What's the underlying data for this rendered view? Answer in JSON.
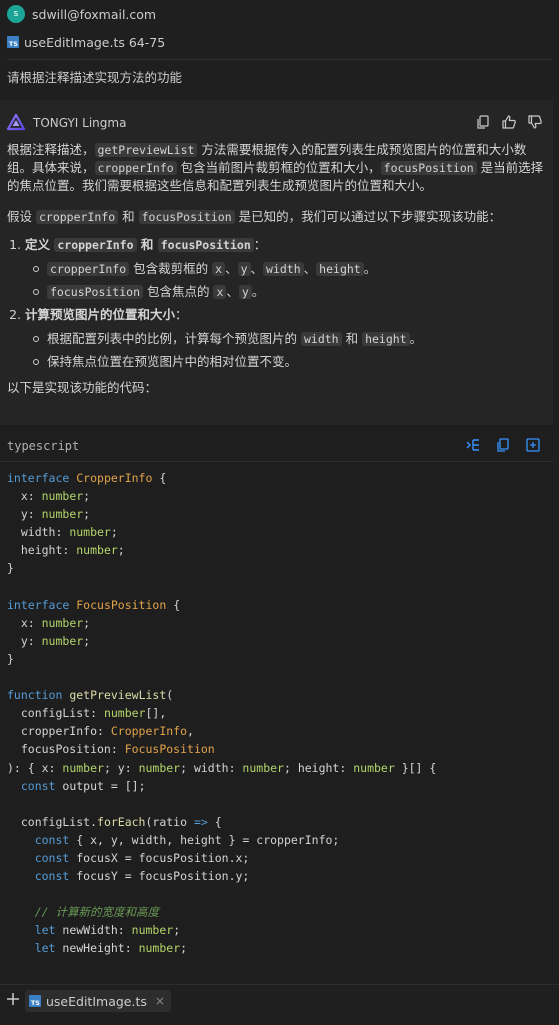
{
  "user": {
    "avatar_letter": "s",
    "email": "sdwill@foxmail.com",
    "file_reference": "useEditImage.ts 64-75",
    "file_icon_text": "TS",
    "question": "请根据注释描述实现方法的功能"
  },
  "answer": {
    "assistant_name": "TONGYI Lingma",
    "header_icons": [
      "copy-icon",
      "thumbs-up-icon",
      "thumbs-down-icon"
    ],
    "p1": {
      "t1": "根据注释描述，",
      "c1": "getPreviewList",
      "t2": " 方法需要根据传入的配置列表生成预览图片的位置和大小数组。具体来说，",
      "c2": "cropperInfo",
      "t3": " 包含当前图片裁剪框的位置和大小，",
      "c3": "focusPosition",
      "t4": " 是当前选择的焦点位置。我们需要根据这些信息和配置列表生成预览图片的位置和大小。"
    },
    "p2": {
      "t1": "假设 ",
      "c1": "cropperInfo",
      "t2": " 和 ",
      "c2": "focusPosition",
      "t3": " 是已知的，我们可以通过以下步骤实现该功能："
    },
    "step1": {
      "b1": "定义 ",
      "c1": "cropperInfo",
      "b2": " 和 ",
      "c2": "focusPosition",
      "t": "：",
      "sub1": {
        "c1": "cropperInfo",
        "t1": " 包含裁剪框的 ",
        "c2": "x",
        "s1": "、",
        "c3": "y",
        "s2": "、",
        "c4": "width",
        "s3": "、",
        "c5": "height",
        "t2": "。"
      },
      "sub2": {
        "c1": "focusPosition",
        "t1": " 包含焦点的 ",
        "c2": "x",
        "s1": "、",
        "c3": "y",
        "t2": "。"
      }
    },
    "step2": {
      "b1": "计算预览图片的位置和大小",
      "t": "：",
      "sub1": {
        "t1": "根据配置列表中的比例，计算每个预览图片的 ",
        "c1": "width",
        "t2": " 和 ",
        "c2": "height",
        "t3": "。"
      },
      "sub2": {
        "t1": "保持焦点位置在预览图片中的相对位置不变。"
      }
    },
    "p_final": "以下是实现该功能的代码："
  },
  "code": {
    "language": "typescript",
    "actions": [
      "insert-icon",
      "copy-icon",
      "new-file-icon"
    ],
    "text": "interface CropperInfo {\n  x: number;\n  y: number;\n  width: number;\n  height: number;\n}\n\ninterface FocusPosition {\n  x: number;\n  y: number;\n}\n\nfunction getPreviewList(\n  configList: number[],\n  cropperInfo: CropperInfo,\n  focusPosition: FocusPosition\n): { x: number; y: number; width: number; height: number }[] {\n  const output = [];\n\n  configList.forEach(ratio => {\n    const { x, y, width, height } = cropperInfo;\n    const focusX = focusPosition.x;\n    const focusY = focusPosition.y;\n\n    // 计算新的宽度和高度\n    let newWidth: number;\n    let newHeight: number;"
  },
  "bottom": {
    "tab_label": "useEditImage.ts",
    "tab_icon_text": "TS",
    "close_glyph": "×"
  },
  "colors": {
    "accent": "#3794ff",
    "avatar": "#1aa596",
    "ts_icon": "#3b7fc4"
  }
}
